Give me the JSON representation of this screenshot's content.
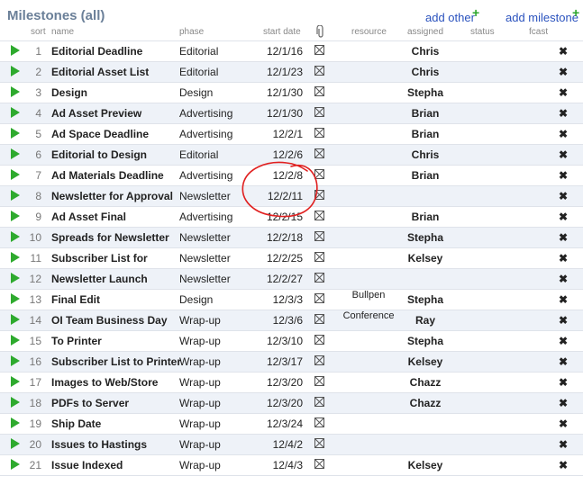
{
  "header": {
    "title": "Milestones (all)",
    "add_other": "add other",
    "add_milestone": "add milestone",
    "plus": "+"
  },
  "columns": {
    "sort": "sort",
    "name": "name",
    "phase": "phase",
    "start_date": "start date",
    "resource": "resource",
    "assigned": "assigned",
    "status": "status",
    "fcast": "fcast"
  },
  "rows": [
    {
      "num": "1",
      "name": "Editorial Deadline",
      "phase": "Editorial",
      "date": "12/1/16",
      "resource": "",
      "assigned": "Chris"
    },
    {
      "num": "2",
      "name": "Editorial Asset List",
      "phase": "Editorial",
      "date": "12/1/23",
      "resource": "",
      "assigned": "Chris"
    },
    {
      "num": "3",
      "name": "Design",
      "phase": "Design",
      "date": "12/1/30",
      "resource": "",
      "assigned": "Stepha"
    },
    {
      "num": "4",
      "name": "Ad Asset Preview",
      "phase": "Advertising",
      "date": "12/1/30",
      "resource": "",
      "assigned": "Brian"
    },
    {
      "num": "5",
      "name": "Ad Space Deadline",
      "phase": "Advertising",
      "date": "12/2/1",
      "resource": "",
      "assigned": "Brian"
    },
    {
      "num": "6",
      "name": "Editorial to Design",
      "phase": "Editorial",
      "date": "12/2/6",
      "resource": "",
      "assigned": "Chris"
    },
    {
      "num": "7",
      "name": "Ad Materials Deadline",
      "phase": "Advertising",
      "date": "12/2/8",
      "resource": "",
      "assigned": "Brian"
    },
    {
      "num": "8",
      "name": "Newsletter for Approval",
      "phase": "Newsletter",
      "date": "12/2/11",
      "resource": "",
      "assigned": ""
    },
    {
      "num": "9",
      "name": "Ad Asset Final",
      "phase": "Advertising",
      "date": "12/2/15",
      "resource": "",
      "assigned": "Brian"
    },
    {
      "num": "10",
      "name": "Spreads for Newsletter",
      "phase": "Newsletter",
      "date": "12/2/18",
      "resource": "",
      "assigned": "Stepha"
    },
    {
      "num": "11",
      "name": "Subscriber List for",
      "phase": "Newsletter",
      "date": "12/2/25",
      "resource": "",
      "assigned": "Kelsey"
    },
    {
      "num": "12",
      "name": "Newsletter Launch",
      "phase": "Newsletter",
      "date": "12/2/27",
      "resource": "",
      "assigned": ""
    },
    {
      "num": "13",
      "name": "Final Edit",
      "phase": "Design",
      "date": "12/3/3",
      "resource": "Bullpen",
      "assigned": "Stepha"
    },
    {
      "num": "14",
      "name": "OI Team Business Day",
      "phase": "Wrap-up",
      "date": "12/3/6",
      "resource": "Conference",
      "assigned": "Ray"
    },
    {
      "num": "15",
      "name": "To Printer",
      "phase": "Wrap-up",
      "date": "12/3/10",
      "resource": "",
      "assigned": "Stepha"
    },
    {
      "num": "16",
      "name": "Subscriber List to Printer",
      "phase": "Wrap-up",
      "date": "12/3/17",
      "resource": "",
      "assigned": "Kelsey"
    },
    {
      "num": "17",
      "name": "Images to Web/Store",
      "phase": "Wrap-up",
      "date": "12/3/20",
      "resource": "",
      "assigned": "Chazz"
    },
    {
      "num": "18",
      "name": "PDFs to Server",
      "phase": "Wrap-up",
      "date": "12/3/20",
      "resource": "",
      "assigned": "Chazz"
    },
    {
      "num": "19",
      "name": "Ship Date",
      "phase": "Wrap-up",
      "date": "12/3/24",
      "resource": "",
      "assigned": ""
    },
    {
      "num": "20",
      "name": "Issues to Hastings",
      "phase": "Wrap-up",
      "date": "12/4/2",
      "resource": "",
      "assigned": ""
    },
    {
      "num": "21",
      "name": "Issue Indexed",
      "phase": "Wrap-up",
      "date": "12/4/3",
      "resource": "",
      "assigned": "Kelsey"
    }
  ],
  "icons": {
    "play": "play-icon",
    "checkbox": "checkbox-icon",
    "delete": "delete-icon",
    "attachment": "paperclip-icon",
    "delete_glyph": "✖"
  },
  "colors": {
    "title": "#6a7f98",
    "link": "#2a52be",
    "play": "#2eaa2e",
    "delete": "#cc2222",
    "annotation": "#e02020"
  }
}
